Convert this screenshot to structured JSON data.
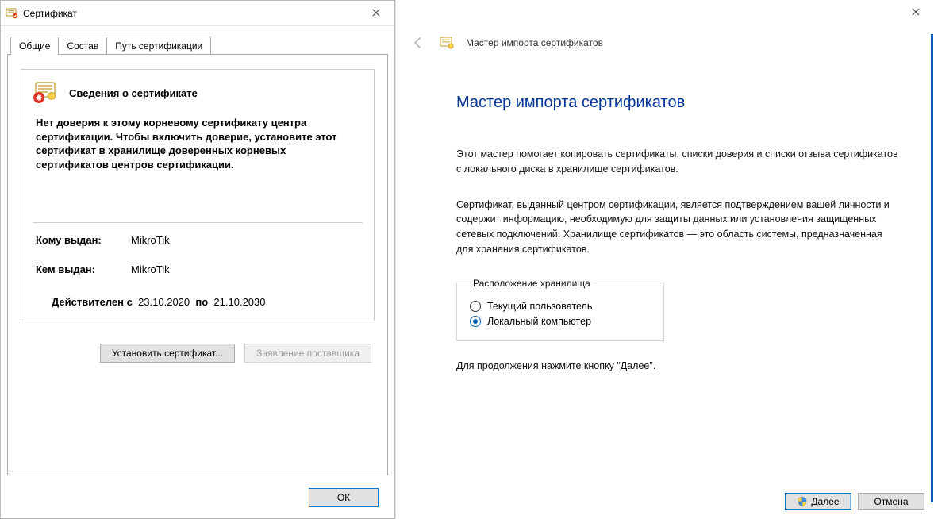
{
  "cert_dialog": {
    "title": "Сертификат",
    "tabs": {
      "general": "Общие",
      "details": "Состав",
      "path": "Путь сертификации"
    },
    "info_title": "Сведения о сертификате",
    "trust_message": "Нет доверия к этому корневому сертификату центра сертификации. Чтобы включить  доверие, установите этот сертификат в хранилище доверенных корневых сертификатов центров сертификации.",
    "issued_to_label": "Кому выдан:",
    "issued_to_value": "MikroTik",
    "issued_by_label": "Кем выдан:",
    "issued_by_value": "MikroTik",
    "valid_from_label": "Действителен с",
    "valid_from_value": "23.10.2020",
    "valid_to_label": "по",
    "valid_to_value": "21.10.2030",
    "install_button": "Установить сертификат...",
    "statement_button": "Заявление поставщика",
    "ok_button": "ОК"
  },
  "wizard": {
    "header_title": "Мастер импорта сертификатов",
    "heading": "Мастер импорта сертификатов",
    "para1": "Этот мастер помогает копировать сертификаты, списки доверия и списки отзыва сертификатов с локального диска в хранилище сертификатов.",
    "para2": "Сертификат, выданный центром сертификации, является подтверждением вашей личности и содержит информацию, необходимую для защиты данных или установления защищенных сетевых подключений. Хранилище сертификатов — это область системы, предназначенная для хранения сертификатов.",
    "group_label": "Расположение хранилища",
    "radio_current_user": "Текущий пользователь",
    "radio_local_machine": "Локальный компьютер",
    "continue_hint": "Для продолжения нажмите кнопку \"Далее\".",
    "next_button": "Далее",
    "cancel_button": "Отмена"
  }
}
